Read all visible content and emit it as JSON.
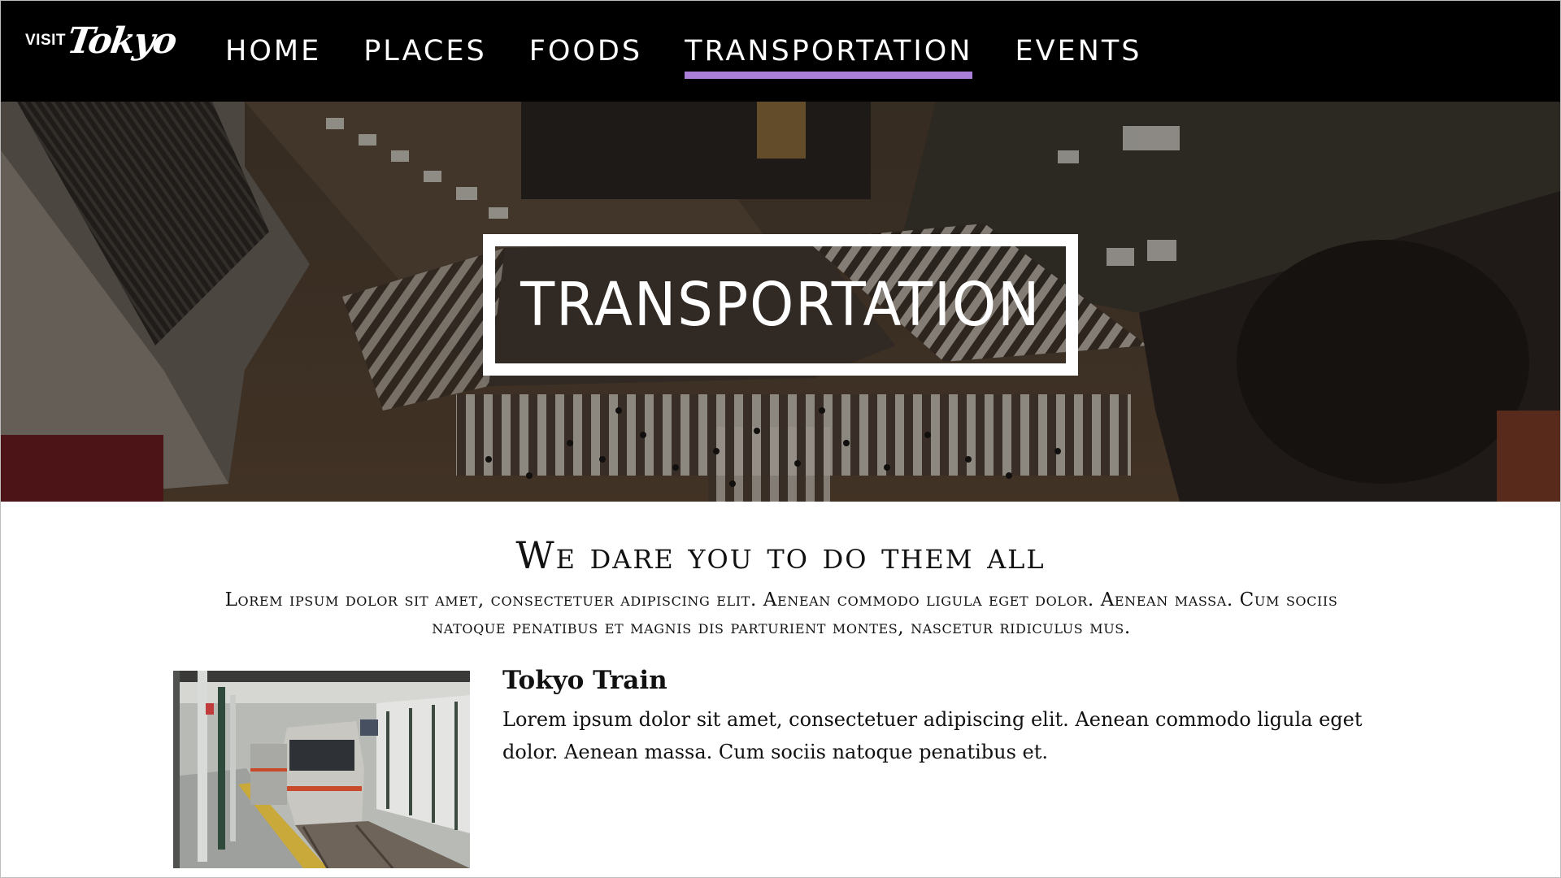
{
  "logo": {
    "prefix": "VISIT",
    "script": "Tokyo"
  },
  "nav": {
    "items": [
      {
        "label": "HOME",
        "active": false
      },
      {
        "label": "PLACES",
        "active": false
      },
      {
        "label": "FOODS",
        "active": false
      },
      {
        "label": "TRANSPORTATION",
        "active": true
      },
      {
        "label": "EVENTS",
        "active": false
      }
    ],
    "active_underline_color": "#a97fd8"
  },
  "hero": {
    "title": "TRANSPORTATION",
    "image": "aerial-crosswalk-photo"
  },
  "section": {
    "heading": "We dare you to do them all",
    "intro": "Lorem ipsum dolor sit amet, consectetuer adipiscing elit. Aenean commodo ligula eget dolor. Aenean massa. Cum sociis natoque penatibus et magnis dis parturient montes, nascetur ridiculus mus."
  },
  "card": {
    "title": "Tokyo Train",
    "text": "Lorem ipsum dolor sit amet, consectetuer adipiscing elit. Aenean commodo ligula eget dolor. Aenean massa. Cum sociis natoque penatibus et.",
    "image": "train-platform-photo"
  },
  "colors": {
    "nav_background": "#000000",
    "accent": "#a97fd8",
    "text": "#111111"
  }
}
